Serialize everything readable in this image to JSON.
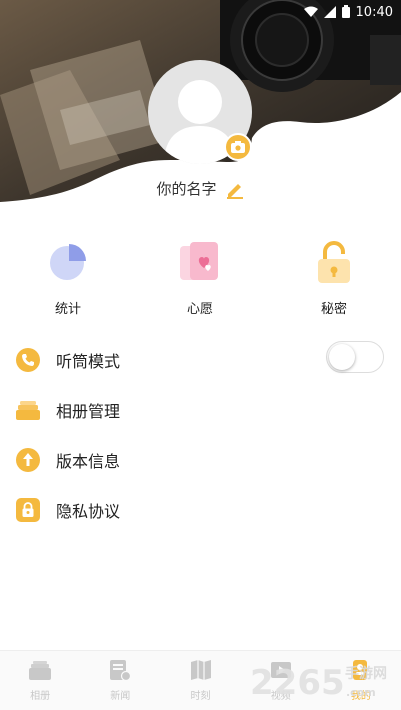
{
  "statusbar": {
    "time": "10:40"
  },
  "profile": {
    "name": "你的名字"
  },
  "shortcuts": [
    {
      "label": "统计",
      "icon": "pie-chart-icon"
    },
    {
      "label": "心愿",
      "icon": "heart-card-icon"
    },
    {
      "label": "秘密",
      "icon": "padlock-icon"
    }
  ],
  "menu": [
    {
      "label": "听筒模式",
      "icon": "phone-icon",
      "toggle": false
    },
    {
      "label": "相册管理",
      "icon": "album-stack-icon"
    },
    {
      "label": "版本信息",
      "icon": "upload-arrow-icon"
    },
    {
      "label": "隐私协议",
      "icon": "privacy-lock-icon"
    }
  ],
  "tabs": [
    {
      "label": "相册",
      "icon": "album-tab-icon",
      "active": false
    },
    {
      "label": "新闻",
      "icon": "news-tab-icon",
      "active": false
    },
    {
      "label": "时刻",
      "icon": "moments-tab-icon",
      "active": false
    },
    {
      "label": "视频",
      "icon": "video-tab-icon",
      "active": false
    },
    {
      "label": "我的",
      "icon": "profile-tab-icon",
      "active": true
    }
  ],
  "watermark": {
    "text": "2265.com",
    "sub": "手游网"
  },
  "colors": {
    "accent": "#f4b93f",
    "tab_inactive": "#c8c8c8"
  }
}
